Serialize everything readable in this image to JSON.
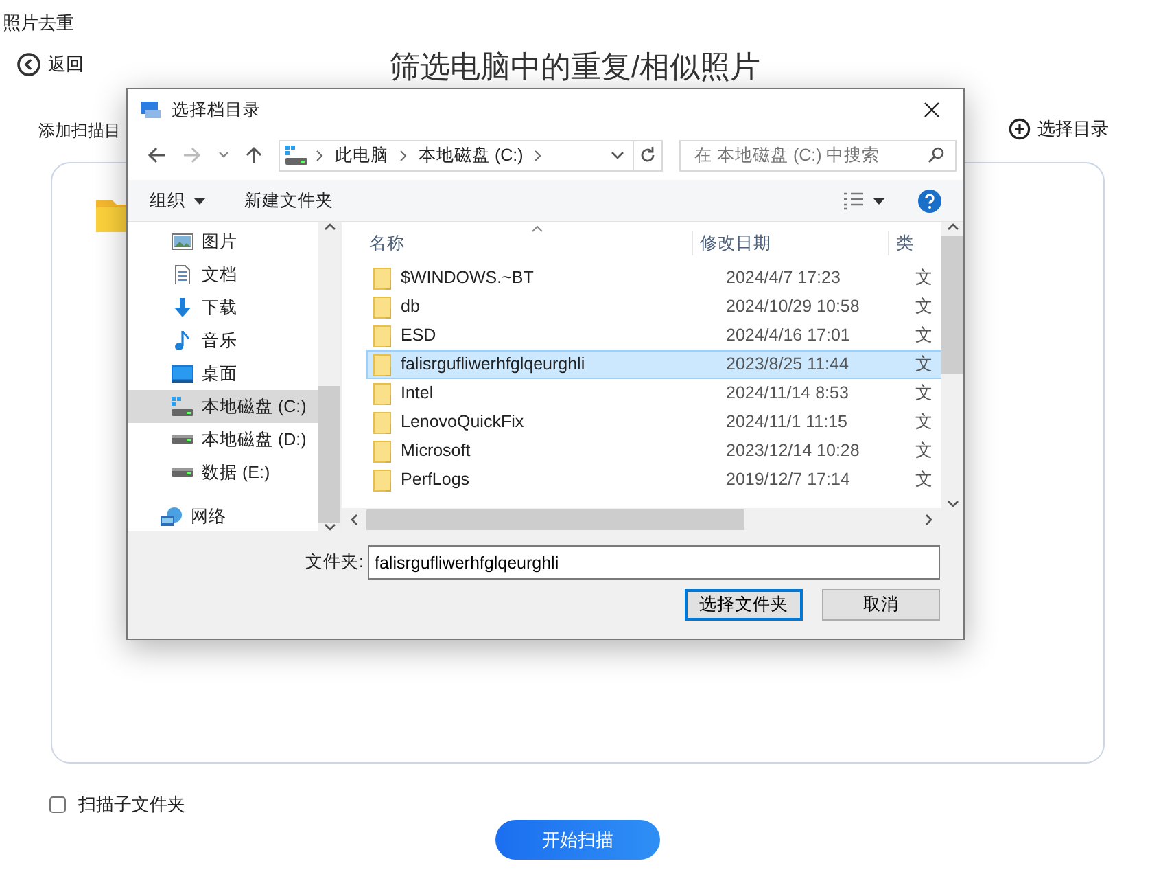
{
  "app": {
    "title": "照片去重",
    "back": "返回",
    "heading": "筛选电脑中的重复/相似照片",
    "add_label": "添加扫描目",
    "choose_dir": "选择目录",
    "scan_subfolders": {
      "label": "扫描子文件夹",
      "checked": false
    },
    "start_button": "开始扫描"
  },
  "dialog": {
    "title": "选择档目录",
    "breadcrumb": [
      "此电脑",
      "本地磁盘 (C:)"
    ],
    "search": {
      "placeholder": "在 本地磁盘 (C:) 中搜索"
    },
    "organize": "组织",
    "new_folder": "新建文件夹",
    "nav": [
      {
        "label": "图片",
        "kind": "pictures",
        "selected": false
      },
      {
        "label": "文档",
        "kind": "documents",
        "selected": false
      },
      {
        "label": "下载",
        "kind": "downloads",
        "selected": false
      },
      {
        "label": "音乐",
        "kind": "music",
        "selected": false
      },
      {
        "label": "桌面",
        "kind": "desktop",
        "selected": false
      },
      {
        "label": "本地磁盘 (C:)",
        "kind": "system_drive",
        "selected": true
      },
      {
        "label": "本地磁盘 (D:)",
        "kind": "drive",
        "selected": false
      },
      {
        "label": "数据 (E:)",
        "kind": "drive",
        "selected": false
      },
      {
        "label": "网络",
        "kind": "network",
        "selected": false
      }
    ],
    "columns": [
      "名称",
      "修改日期",
      "类"
    ],
    "rows": [
      {
        "name": "$WINDOWS.~BT",
        "date": "2024/4/7 17:23",
        "column_3": "文",
        "selected": false
      },
      {
        "name": "db",
        "date": "2024/10/29 10:58",
        "column_3": "文",
        "selected": false
      },
      {
        "name": "ESD",
        "date": "2024/4/16 17:01",
        "column_3": "文",
        "selected": false
      },
      {
        "name": "falisrgufliwerhfglqeurghli",
        "date": "2023/8/25 11:44",
        "column_3": "文",
        "selected": true
      },
      {
        "name": "Intel",
        "date": "2024/11/14 8:53",
        "column_3": "文",
        "selected": false
      },
      {
        "name": "LenovoQuickFix",
        "date": "2024/11/1 11:15",
        "column_3": "文",
        "selected": false
      },
      {
        "name": "Microsoft",
        "date": "2023/12/14 10:28",
        "column_3": "文",
        "selected": false
      },
      {
        "name": "PerfLogs",
        "date": "2019/12/7 17:14",
        "column_3": "文",
        "selected": false
      }
    ],
    "folder_label": "文件夹:",
    "folder_value": "falisrgufliwerhfglqeurghli",
    "buttons": [
      "选择文件夹",
      "取消"
    ]
  }
}
